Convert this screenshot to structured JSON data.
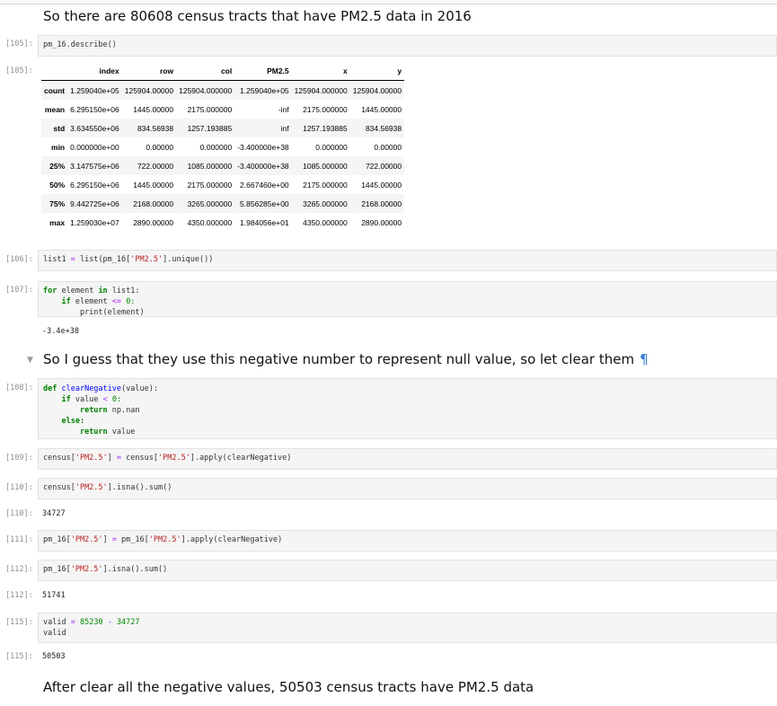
{
  "heading1": "So there are 80608 census tracts that have PM2.5 data in 2016",
  "cells": {
    "c105_prompt": "[105]:",
    "c105_code": "pm_16.describe()",
    "c105_out_prompt": "[105]:",
    "c106_prompt": "[106]:",
    "c107_prompt": "[107]:",
    "c107_output": "-3.4e+38",
    "c108_prompt": "[108]:",
    "c109_prompt": "[109]:",
    "c110_prompt": "[110]:",
    "c110_out_prompt": "[110]:",
    "c110_output": "34727",
    "c111_prompt": "[111]:",
    "c112_prompt": "[112]:",
    "c112_out_prompt": "[112]:",
    "c112_output": "51741",
    "c115_prompt": "[115]:",
    "c115_out_prompt": "[115]:",
    "c115_output": "50503"
  },
  "heading2": "So I guess that they use this negative number to represent null value, so let clear them",
  "heading3": "After clear all the negative values, 50503 census tracts have PM2.5 data",
  "describe_table": {
    "columns": [
      "index",
      "row",
      "col",
      "PM2.5",
      "x",
      "y"
    ],
    "rows": [
      {
        "label": "count",
        "values": [
          "1.259040e+05",
          "125904.00000",
          "125904.000000",
          "1.259040e+05",
          "125904.000000",
          "125904.00000"
        ]
      },
      {
        "label": "mean",
        "values": [
          "6.295150e+06",
          "1445.00000",
          "2175.000000",
          "-inf",
          "2175.000000",
          "1445.00000"
        ]
      },
      {
        "label": "std",
        "values": [
          "3.634550e+06",
          "834.56938",
          "1257.193885",
          "inf",
          "1257.193885",
          "834.56938"
        ]
      },
      {
        "label": "min",
        "values": [
          "0.000000e+00",
          "0.00000",
          "0.000000",
          "-3.400000e+38",
          "0.000000",
          "0.00000"
        ]
      },
      {
        "label": "25%",
        "values": [
          "3.147575e+06",
          "722.00000",
          "1085.000000",
          "-3.400000e+38",
          "1085.000000",
          "722.00000"
        ]
      },
      {
        "label": "50%",
        "values": [
          "6.295150e+06",
          "1445.00000",
          "2175.000000",
          "2.667460e+00",
          "2175.000000",
          "1445.00000"
        ]
      },
      {
        "label": "75%",
        "values": [
          "9.442725e+06",
          "2168.00000",
          "3265.000000",
          "5.856285e+00",
          "3265.000000",
          "2168.00000"
        ]
      },
      {
        "label": "max",
        "values": [
          "1.259030e+07",
          "2890.00000",
          "4350.000000",
          "1.984056e+01",
          "4350.000000",
          "2890.00000"
        ]
      }
    ]
  },
  "tokens": {
    "list1": "list1",
    "eq": "=",
    "list_call": "list(pm_16[",
    "pm25_str": "'PM2.5'",
    "unique_tail": "].unique())",
    "for_kw": "for",
    "element": "element",
    "in_kw": "in",
    "list1_colon": "list1:",
    "if_kw": "if",
    "le": "<=",
    "zero_colon": "0:",
    "print_call": "print(element)",
    "def_kw": "def",
    "fn_name": "clearNegative",
    "fn_args": "(value):",
    "value": "value",
    "lt": "<",
    "return_kw": "return",
    "npnan": "np.nan",
    "else_kw": "else:",
    "census_open": "census[",
    "close_br": "]",
    "apply_call": ".apply(clearNegative)",
    "isna_call": ".isna().sum()",
    "pm16_open": "pm_16[",
    "valid": "valid",
    "n85230": "85230",
    "minus": "-",
    "n34727": "34727",
    "pilcrow": "¶",
    "arrow": "▼"
  }
}
